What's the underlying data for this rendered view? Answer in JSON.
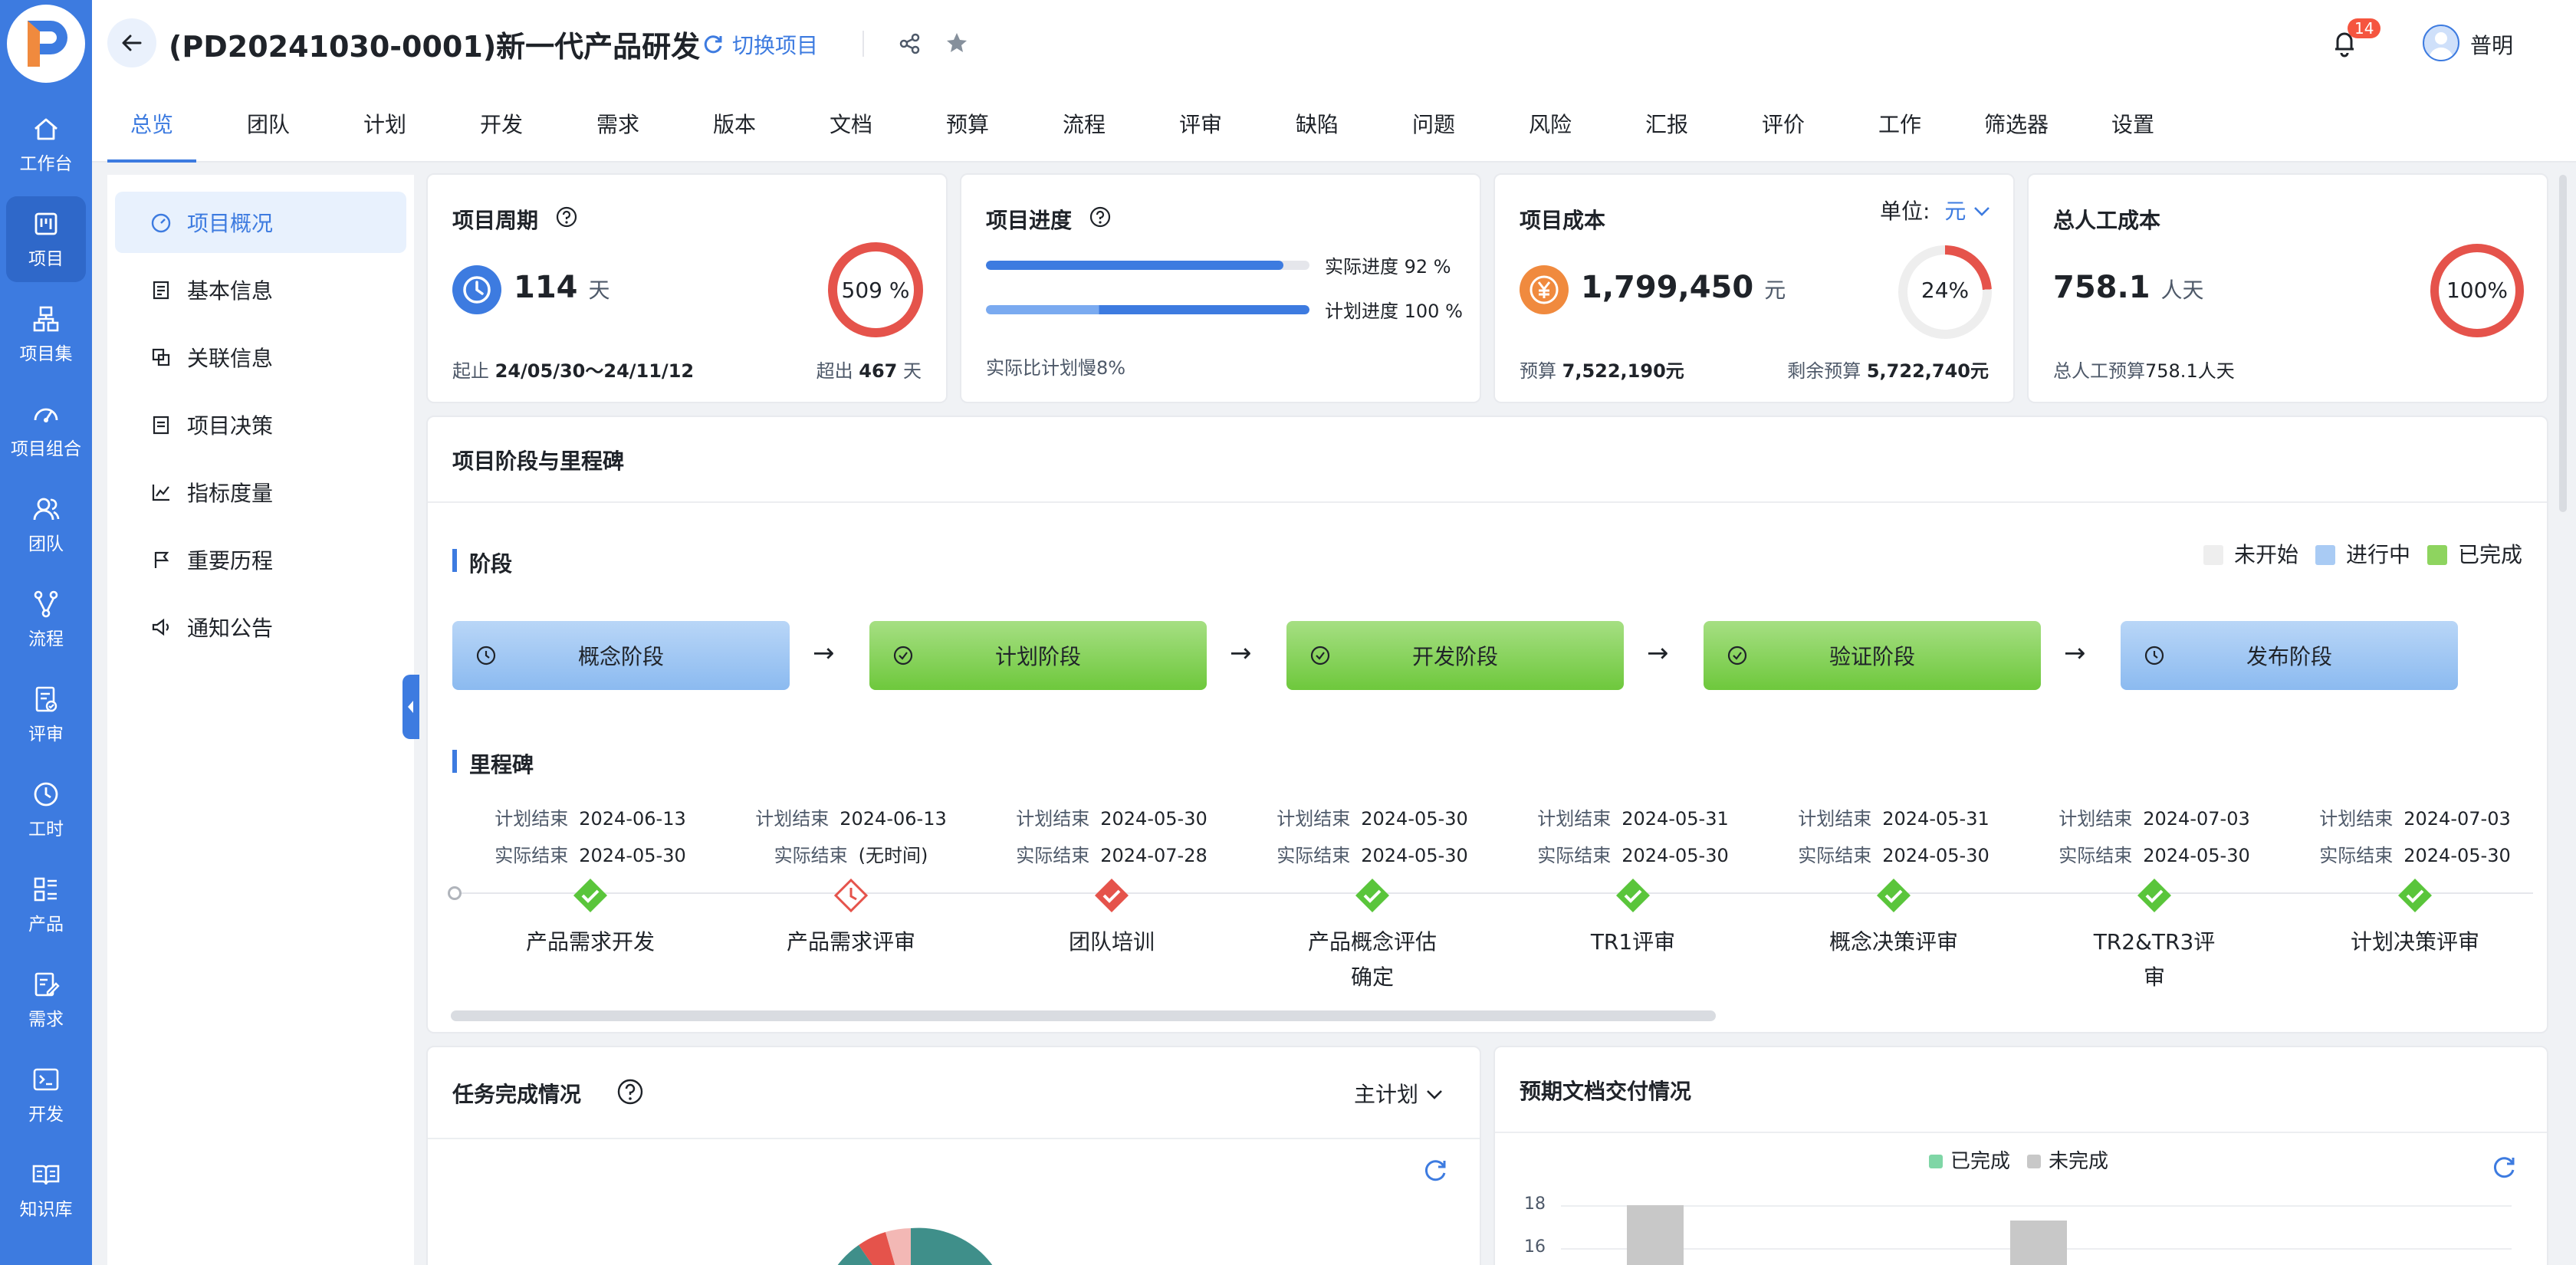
{
  "rail": {
    "items": [
      {
        "label": "工作台",
        "icon": "home-icon"
      },
      {
        "label": "项目",
        "icon": "project-icon"
      },
      {
        "label": "项目集",
        "icon": "program-icon"
      },
      {
        "label": "项目组合",
        "icon": "portfolio-icon"
      },
      {
        "label": "团队",
        "icon": "team-icon"
      },
      {
        "label": "流程",
        "icon": "flow-icon"
      },
      {
        "label": "评审",
        "icon": "review-icon"
      },
      {
        "label": "工时",
        "icon": "clock-icon"
      },
      {
        "label": "产品",
        "icon": "product-icon"
      },
      {
        "label": "需求",
        "icon": "requirement-icon"
      },
      {
        "label": "开发",
        "icon": "terminal-icon"
      },
      {
        "label": "知识库",
        "icon": "book-icon"
      }
    ],
    "active": "项目"
  },
  "header": {
    "title": "(PD20241030-0001)新一代产品研发",
    "switch_label": "切换项目",
    "notification_count": "14",
    "user_name": "普明"
  },
  "tabs": [
    "总览",
    "团队",
    "计划",
    "开发",
    "需求",
    "版本",
    "文档",
    "预算",
    "流程",
    "评审",
    "缺陷",
    "问题",
    "风险",
    "汇报",
    "评价",
    "工作",
    "筛选器",
    "设置"
  ],
  "active_tab": "总览",
  "sidenav": {
    "items": [
      "项目概况",
      "基本信息",
      "关联信息",
      "项目决策",
      "指标度量",
      "重要历程",
      "通知公告"
    ],
    "active": "项目概况"
  },
  "period": {
    "title": "项目周期",
    "value": "114",
    "unit": "天",
    "ring_text": "509 %",
    "range_label": "起止",
    "range": "24/05/30～24/11/12",
    "over_label": "超出",
    "over_value": "467",
    "over_unit": "天"
  },
  "progress": {
    "title": "项目进度",
    "actual_label": "实际进度 92 %",
    "actual": 0.92,
    "plan_label": "计划进度 100 %",
    "plan": 1.0,
    "note": "实际比计划慢8%"
  },
  "cost": {
    "title": "项目成本",
    "unit_label": "单位:",
    "unit_value": "元",
    "value": "1,799,450",
    "value_unit": "元",
    "ring_text": "24%",
    "ring_pct": 0.24,
    "budget_label": "预算",
    "budget": "7,522,190元",
    "remain_label": "剩余预算",
    "remain": "5,722,740元"
  },
  "labor": {
    "title": "总人工成本",
    "value": "758.1",
    "unit": "人天",
    "ring_text": "100%",
    "budget_label": "总人工预算",
    "budget": "758.1人天"
  },
  "milestone_card": {
    "title": "项目阶段与里程碑",
    "stage_heading": "阶段",
    "legend": [
      {
        "label": "未开始",
        "color": "#eeeeee"
      },
      {
        "label": "进行中",
        "color": "#a9cbf4"
      },
      {
        "label": "已完成",
        "color": "#8ed45f"
      }
    ],
    "stages": [
      {
        "name": "概念阶段",
        "status": "in-progress"
      },
      {
        "name": "计划阶段",
        "status": "done"
      },
      {
        "name": "开发阶段",
        "status": "done"
      },
      {
        "name": "验证阶段",
        "status": "done"
      },
      {
        "name": "发布阶段",
        "status": "in-progress"
      }
    ],
    "milestone_heading": "里程碑",
    "plan_label": "计划结束",
    "actual_label": "实际结束",
    "milestones": [
      {
        "name": "产品需求开发",
        "plan": "2024-06-13",
        "actual": "2024-05-30",
        "state": "done"
      },
      {
        "name": "产品需求评审",
        "plan": "2024-06-13",
        "actual": "(无时间)",
        "state": "pending"
      },
      {
        "name": "团队培训",
        "plan": "2024-05-30",
        "actual": "2024-07-28",
        "state": "late"
      },
      {
        "name": "产品概念评估确定",
        "plan": "2024-05-30",
        "actual": "2024-05-30",
        "state": "done"
      },
      {
        "name": "TR1评审",
        "plan": "2024-05-31",
        "actual": "2024-05-30",
        "state": "done"
      },
      {
        "name": "概念决策评审",
        "plan": "2024-05-31",
        "actual": "2024-05-30",
        "state": "done"
      },
      {
        "name": "TR2&TR3评审",
        "plan": "2024-07-03",
        "actual": "2024-05-30",
        "state": "done"
      },
      {
        "name": "计划决策评审",
        "plan": "2024-07-03",
        "actual": "2024-05-30",
        "state": "done"
      }
    ]
  },
  "task_card": {
    "title": "任务完成情况",
    "selector": "主计划"
  },
  "doc_card": {
    "title": "预期文档交付情况",
    "legend": [
      {
        "label": "已完成",
        "color": "#7fd6a6"
      },
      {
        "label": "未完成",
        "color": "#c8c8c8"
      }
    ],
    "y_ticks": [
      "18",
      "16"
    ]
  },
  "colors": {
    "primary": "#3d7be0",
    "danger": "#e5534b",
    "success": "#5ac53b",
    "warning": "#f08a3e"
  }
}
